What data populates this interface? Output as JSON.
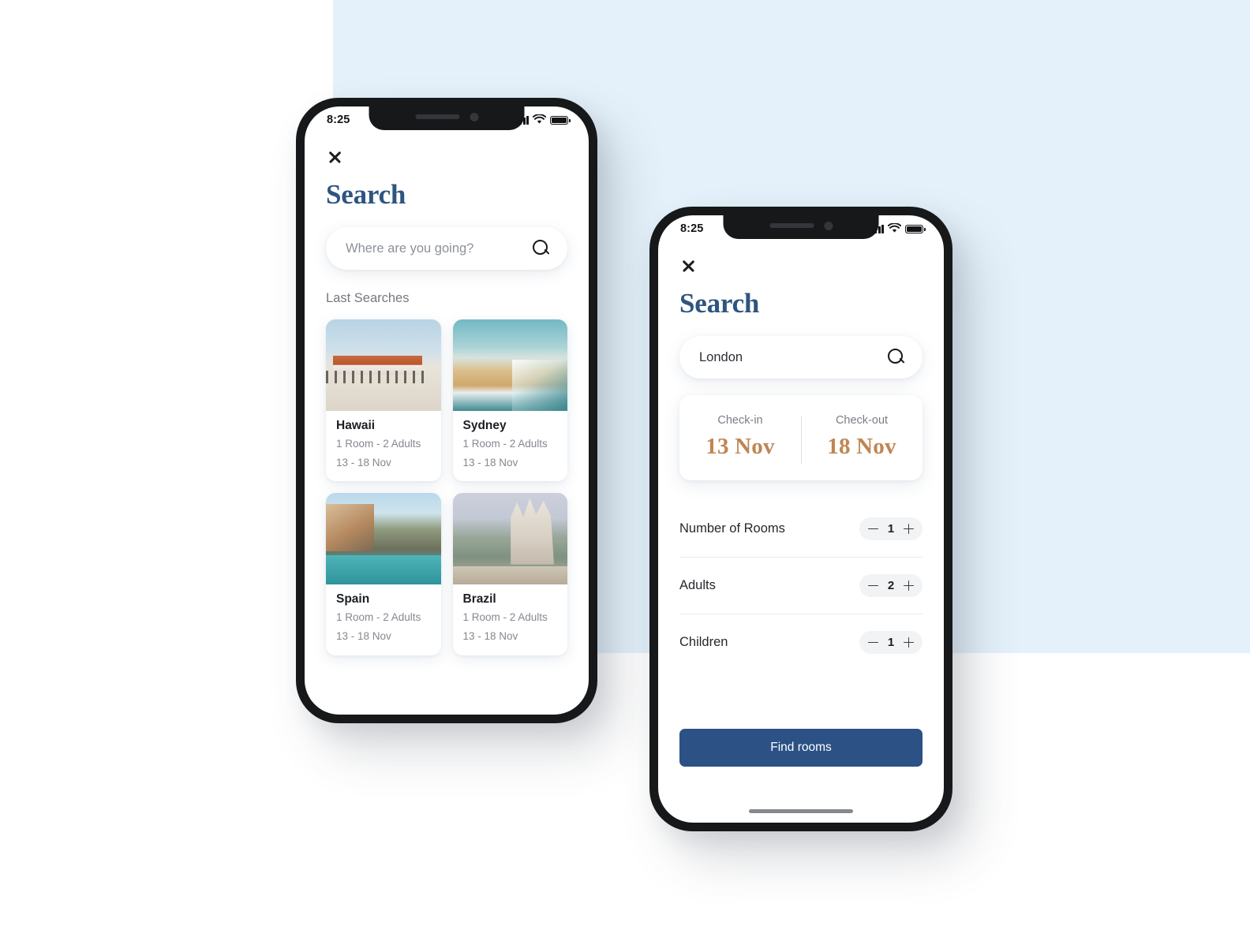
{
  "canvas": {
    "background_white": "#ffffff",
    "background_blue": "#e4f1fa"
  },
  "theme": {
    "title_blue": "#2e5580",
    "date_bronze": "#c08552",
    "button_navy": "#2b5185",
    "muted_text": "#84888f"
  },
  "phone1": {
    "status": {
      "time": "8:25",
      "signal_icon": "signal-bars-icon",
      "wifi_icon": "wifi-icon",
      "battery_icon": "battery-icon"
    },
    "close_icon": "close-icon",
    "title": "Search",
    "search": {
      "placeholder": "Where are you going?",
      "value": "",
      "icon": "search-icon"
    },
    "section_label": "Last Searches",
    "cards": [
      {
        "name": "Hawaii",
        "guests": "1 Room - 2 Adults",
        "dates": "13 - 18 Nov",
        "thumb": "beach-pier-photo"
      },
      {
        "name": "Sydney",
        "guests": "1 Room - 2 Adults",
        "dates": "13 - 18 Nov",
        "thumb": "sandy-shoreline-photo"
      },
      {
        "name": "Spain",
        "guests": "1 Room - 2 Adults",
        "dates": "13 - 18 Nov",
        "thumb": "coastal-cliff-photo"
      },
      {
        "name": "Brazil",
        "guests": "1 Room - 2 Adults",
        "dates": "13 - 18 Nov",
        "thumb": "cathedral-hill-photo"
      }
    ]
  },
  "phone2": {
    "status": {
      "time": "8:25",
      "signal_icon": "signal-bars-icon",
      "wifi_icon": "wifi-icon",
      "battery_icon": "battery-icon"
    },
    "close_icon": "close-icon",
    "title": "Search",
    "search": {
      "placeholder": "Where are you going?",
      "value": "London",
      "icon": "search-icon"
    },
    "dates": {
      "checkin_label": "Check-in",
      "checkin_value": "13 Nov",
      "checkout_label": "Check-out",
      "checkout_value": "18 Nov"
    },
    "steppers": [
      {
        "label": "Number of Rooms",
        "value": "1",
        "minus": "minus-icon",
        "plus": "plus-icon"
      },
      {
        "label": "Adults",
        "value": "2",
        "minus": "minus-icon",
        "plus": "plus-icon"
      },
      {
        "label": "Children",
        "value": "1",
        "minus": "minus-icon",
        "plus": "plus-icon"
      }
    ],
    "cta": "Find rooms"
  }
}
